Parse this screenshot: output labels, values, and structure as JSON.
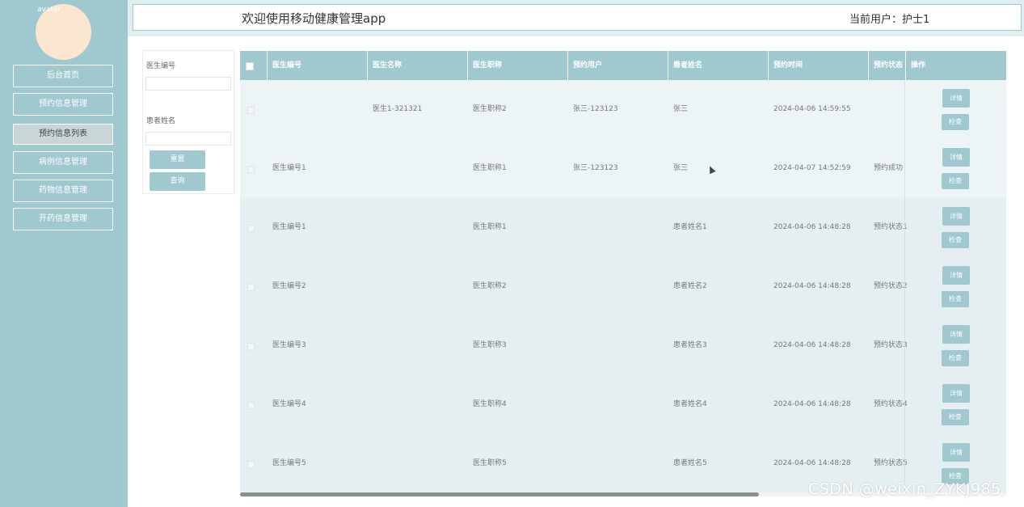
{
  "sidebar": {
    "avatar_alt": "avatar",
    "items": [
      {
        "label": "后台首页",
        "active": false
      },
      {
        "label": "预约信息管理",
        "active": false
      },
      {
        "label": "预约信息列表",
        "active": true
      },
      {
        "label": "病例信息管理",
        "active": false
      },
      {
        "label": "药物信息管理",
        "active": false
      },
      {
        "label": "开药信息管理",
        "active": false
      }
    ]
  },
  "header": {
    "title": "欢迎使用移动健康管理app",
    "current_user": "当前用户：护士1"
  },
  "search": {
    "doctor_no_label": "医生编号",
    "doctor_no_value": "",
    "patient_name_label": "患者姓名",
    "patient_name_value": "",
    "reset_label": "重置",
    "query_label": "查询"
  },
  "table": {
    "headers": [
      "医生编号",
      "医生名称",
      "医生职称",
      "预约用户",
      "患者姓名",
      "预约时间",
      "预约状态",
      "操作"
    ],
    "detail_label": "详情",
    "check_label": "检查",
    "rows": [
      {
        "doctor_no": "",
        "doctor_name": "医生1-321321",
        "doctor_title": "医生职称2",
        "user": "张三-123123",
        "patient": "张三",
        "time": "2024-04-06 14:59:55",
        "status": ""
      },
      {
        "doctor_no": "医生编号1",
        "doctor_name": "",
        "doctor_title": "医生职称1",
        "user": "张三-123123",
        "patient": "张三",
        "time": "2024-04-07 14:52:59",
        "status": "预约成功"
      },
      {
        "doctor_no": "医生编号1",
        "doctor_name": "",
        "doctor_title": "医生职称1",
        "user": "",
        "patient": "患者姓名1",
        "time": "2024-04-06 14:48:28",
        "status": "预约状态1"
      },
      {
        "doctor_no": "医生编号2",
        "doctor_name": "",
        "doctor_title": "医生职称2",
        "user": "",
        "patient": "患者姓名2",
        "time": "2024-04-06 14:48:28",
        "status": "预约状态2"
      },
      {
        "doctor_no": "医生编号3",
        "doctor_name": "",
        "doctor_title": "医生职称3",
        "user": "",
        "patient": "患者姓名3",
        "time": "2024-04-06 14:48:28",
        "status": "预约状态3"
      },
      {
        "doctor_no": "医生编号4",
        "doctor_name": "",
        "doctor_title": "医生职称4",
        "user": "",
        "patient": "患者姓名4",
        "time": "2024-04-06 14:48:28",
        "status": "预约状态4"
      },
      {
        "doctor_no": "医生编号5",
        "doctor_name": "",
        "doctor_title": "医生职称5",
        "user": "",
        "patient": "患者姓名5",
        "time": "2024-04-06 14:48:28",
        "status": "预约状态5"
      }
    ]
  },
  "watermark": "CSDN @weixin_ZYKJ985",
  "colors": {
    "accent": "#9fc8cf",
    "row_light": "#edf4f5",
    "row_dark": "#e5eff1",
    "avatar": "#fde6cf"
  }
}
